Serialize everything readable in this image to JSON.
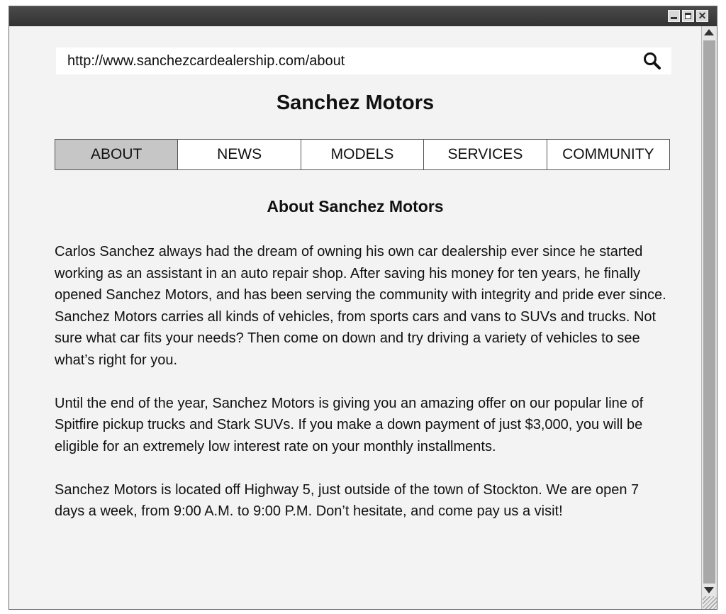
{
  "browser": {
    "url": "http://www.sanchezcardealership.com/about",
    "close_glyph": "✕"
  },
  "site": {
    "title": "Sanchez Motors"
  },
  "nav": {
    "items": [
      {
        "label": "ABOUT",
        "active": true
      },
      {
        "label": "NEWS",
        "active": false
      },
      {
        "label": "MODELS",
        "active": false
      },
      {
        "label": "SERVICES",
        "active": false
      },
      {
        "label": "COMMUNITY",
        "active": false
      }
    ]
  },
  "main": {
    "heading": "About Sanchez Motors",
    "paragraphs": [
      "Carlos Sanchez always had the dream of owning his own car dealership ever since he started working as an assistant in an auto repair shop. After saving his money for ten years, he finally opened Sanchez Motors, and has been serving the community with integrity and pride ever since. Sanchez Motors carries all kinds of vehicles, from sports cars and vans to SUVs and trucks. Not sure what car fits your needs? Then come on down and try driving a variety of vehicles to see what’s right for you.",
      "Until the end of the year, Sanchez Motors is giving you an amazing offer on our popular line of Spitfire pickup trucks and Stark SUVs. If you make a down payment of just $3,000, you will be eligible for an extremely low interest rate on your monthly installments.",
      "Sanchez Motors is located off Highway 5, just outside of the town of Stockton. We are open 7 days a week, from 9:00 A.M. to 9:00 P.M. Don’t hesitate, and come pay us a visit!"
    ]
  }
}
